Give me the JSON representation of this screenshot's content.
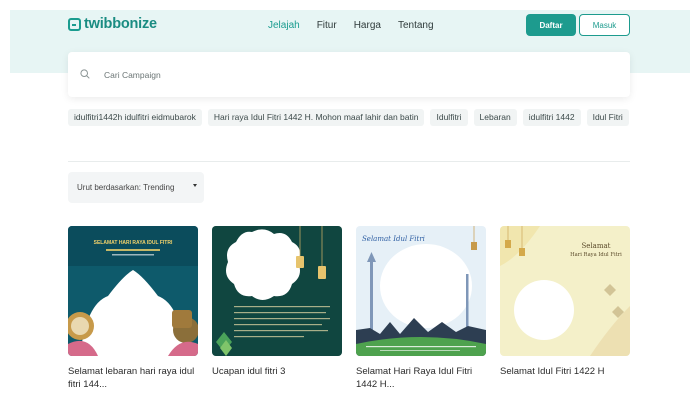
{
  "brand": {
    "name": "twibbonize",
    "accent": "#1d9b8e"
  },
  "nav": {
    "items": [
      {
        "label": "Jelajah",
        "active": true
      },
      {
        "label": "Fitur"
      },
      {
        "label": "Harga"
      },
      {
        "label": "Tentang"
      }
    ]
  },
  "auth": {
    "register_label": "Daftar",
    "login_label": "Masuk"
  },
  "search": {
    "placeholder": "Cari Campaign"
  },
  "tags": [
    "idulfitri1442h idulfitri eidmubarok",
    "Hari raya Idul Fitri 1442 H. Mohon maaf lahir dan batin",
    "Idulfitri",
    "Lebaran",
    "idulfitri 1442",
    "Idul Fitri"
  ],
  "sort": {
    "label": "Urut berdasarkan: Trending"
  },
  "cards": [
    {
      "title": "Selamat lebaran hari raya idul fitri 144..."
    },
    {
      "title": "Ucapan idul fitri 3"
    },
    {
      "title": "Selamat Hari Raya Idul Fitri 1442 H..."
    },
    {
      "title": "Selamat Idul Fitri 1422 H"
    }
  ],
  "thumb_text": {
    "card1_heading": "SELAMAT HARI RAYA IDUL FITRI",
    "card3_script": "Selamat Idul Fitri",
    "card4_heading_line1": "Selamat",
    "card4_heading_line2": "Hari Raya Idul Fitri"
  }
}
